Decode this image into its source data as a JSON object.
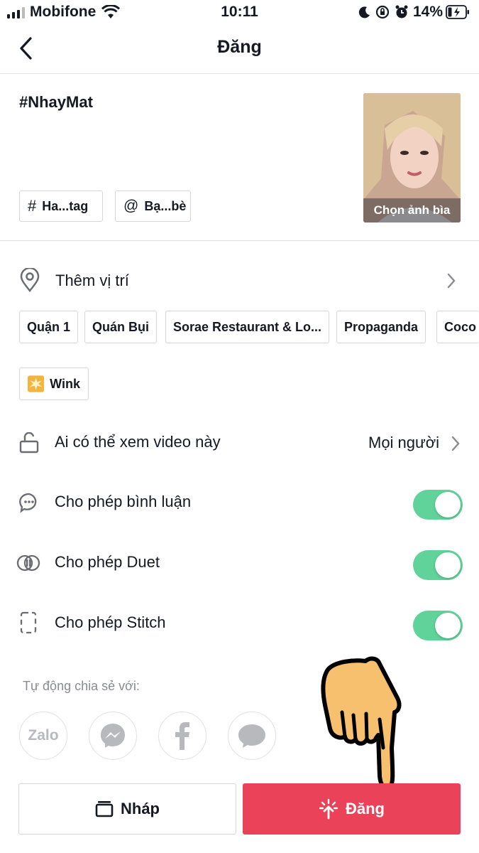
{
  "status_bar": {
    "carrier": "Mobifone",
    "time": "10:11",
    "battery_percent": "14%"
  },
  "header": {
    "title": "Đăng",
    "back_icon": "chevron-left-icon"
  },
  "post": {
    "caption": "#NhayMat",
    "hashtag_button": "Ha...tag",
    "mention_button": "Bạ...bè",
    "cover_label": "Chọn ảnh bìa"
  },
  "location": {
    "label": "Thêm vị trí",
    "suggestions": [
      "Quận 1",
      "Quán Bụi",
      "Sorae Restaurant & Lo...",
      "Propaganda",
      "Coco"
    ]
  },
  "effect_chip": {
    "label": "Wink"
  },
  "settings": {
    "privacy_label": "Ai có thể xem video này",
    "privacy_value": "Mọi người",
    "comments_label": "Cho phép bình luận",
    "duet_label": "Cho phép Duet",
    "stitch_label": "Cho phép Stitch",
    "comments_on": true,
    "duet_on": true,
    "stitch_on": true
  },
  "share": {
    "label": "Tự động chia sẻ với:",
    "zalo_text": "Zalo",
    "targets": [
      "zalo-icon",
      "messenger-icon",
      "facebook-icon",
      "message-icon"
    ]
  },
  "actions": {
    "draft_label": "Nháp",
    "post_label": "Đăng"
  },
  "colors": {
    "accent": "#EA4359",
    "toggle_on": "#5FD39A",
    "text": "#161823",
    "muted": "#8A8B91"
  }
}
